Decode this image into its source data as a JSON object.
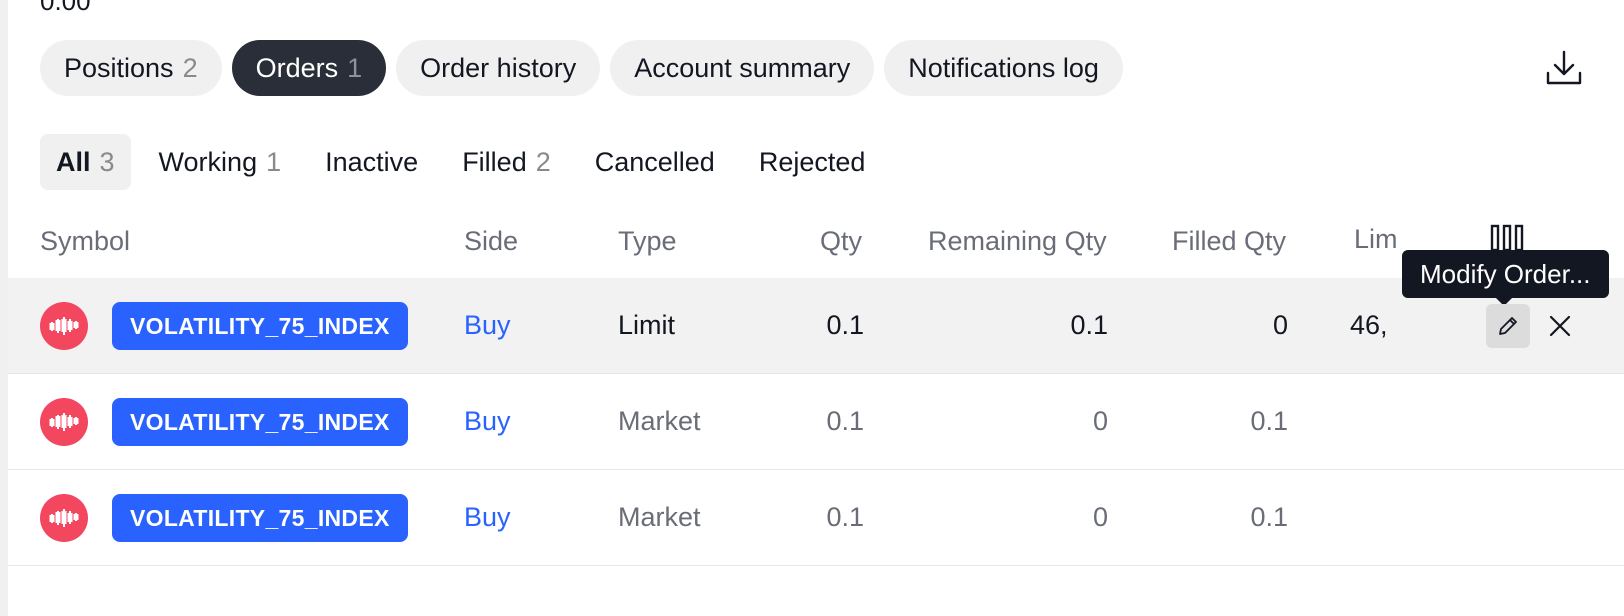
{
  "top_cut_text": "0.00",
  "main_tabs": [
    {
      "label": "Positions",
      "count": "2",
      "active": false
    },
    {
      "label": "Orders",
      "count": "1",
      "active": true
    },
    {
      "label": "Order history",
      "count": "",
      "active": false
    },
    {
      "label": "Account summary",
      "count": "",
      "active": false
    },
    {
      "label": "Notifications log",
      "count": "",
      "active": false
    }
  ],
  "sub_tabs": [
    {
      "label": "All",
      "count": "3",
      "active": true
    },
    {
      "label": "Working",
      "count": "1",
      "active": false
    },
    {
      "label": "Inactive",
      "count": "",
      "active": false
    },
    {
      "label": "Filled",
      "count": "2",
      "active": false
    },
    {
      "label": "Cancelled",
      "count": "",
      "active": false
    },
    {
      "label": "Rejected",
      "count": "",
      "active": false
    }
  ],
  "columns": {
    "symbol": "Symbol",
    "side": "Side",
    "type": "Type",
    "qty": "Qty",
    "remaining_qty": "Remaining Qty",
    "filled_qty": "Filled Qty",
    "limit": "Lim"
  },
  "rows": [
    {
      "symbol": "VOLATILITY_75_INDEX",
      "side": "Buy",
      "type": "Limit",
      "qty": "0.1",
      "remaining_qty": "0.1",
      "filled_qty": "0",
      "limit": "46,"
    },
    {
      "symbol": "VOLATILITY_75_INDEX",
      "side": "Buy",
      "type": "Market",
      "qty": "0.1",
      "remaining_qty": "0",
      "filled_qty": "0.1",
      "limit": ""
    },
    {
      "symbol": "VOLATILITY_75_INDEX",
      "side": "Buy",
      "type": "Market",
      "qty": "0.1",
      "remaining_qty": "0",
      "filled_qty": "0.1",
      "limit": ""
    }
  ],
  "tooltip": "Modify Order...",
  "icons": {
    "download": "download-icon",
    "columns": "columns-settings-icon",
    "symbol": "candlestick-icon",
    "edit": "pencil-icon",
    "close": "close-icon"
  },
  "colors": {
    "accent": "#2962ff",
    "active_tab": "#2a2e39",
    "symbol_icon": "#f2475f",
    "tooltip": "#131722"
  }
}
